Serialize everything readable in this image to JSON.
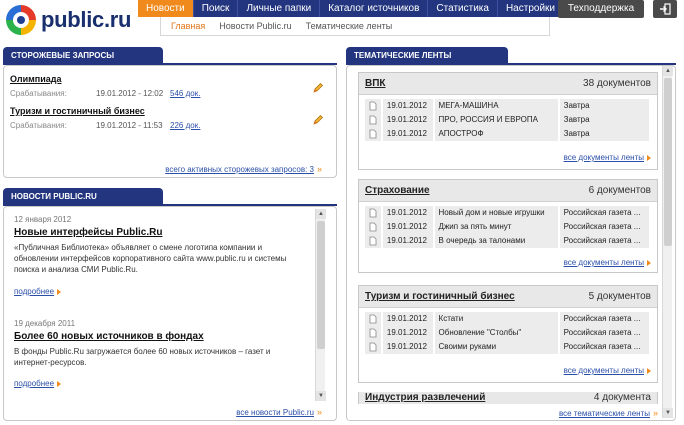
{
  "logo": {
    "text": "public.ru"
  },
  "nav": {
    "items": [
      "Новости",
      "Поиск",
      "Личные папки",
      "Каталог источников",
      "Статистика",
      "Настройки"
    ],
    "active_index": 0
  },
  "subnav": {
    "items": [
      "Главная",
      "Новости Public.ru",
      "Тематические ленты"
    ],
    "active_index": 0
  },
  "support": {
    "label": "Техподдержка"
  },
  "watch": {
    "title": "СТОРОЖЕВЫЕ ЗАПРОСЫ",
    "items": [
      {
        "name": "Олимпиада",
        "label": "Срабатывания:",
        "date": "19.01.2012 - 12:02",
        "count": "546 док."
      },
      {
        "name": "Туризм и гостиничный бизнес",
        "label": "Срабатывания:",
        "date": "19.01.2012 - 11:53",
        "count": "226 док."
      }
    ],
    "all_link": "всего активных сторожевых запросов: 3"
  },
  "news": {
    "title": "НОВОСТИ PUBLIC.RU",
    "items": [
      {
        "date": "12 января 2012",
        "headline": "Новые интерфейсы Public.Ru",
        "text": "«Публичная Библиотека» объявляет о смене логотипа компании и обновлении интерфейсов корпоративного сайта www.public.ru и системы поиска и анализа СМИ Public.Ru.",
        "more": "подробнее"
      },
      {
        "date": "19 декабря 2011",
        "headline": "Более 60 новых источников в фондах",
        "text": "В фонды Public.Ru загружается более 60 новых источников – газет и интернет-ресурсов.",
        "more": "подробнее"
      }
    ],
    "all_link": "все новости Public.ru"
  },
  "feeds": {
    "title": "ТЕМАТИЧЕСКИЕ ЛЕНТЫ",
    "items": [
      {
        "name": "ВПК",
        "count": "38 документов",
        "rows": [
          {
            "date": "19.01.2012",
            "title": "МЕГА-МАШИНА",
            "source": "Завтра"
          },
          {
            "date": "19.01.2012",
            "title": "ПРО, РОССИЯ И ЕВРОПА",
            "source": "Завтра"
          },
          {
            "date": "19.01.2012",
            "title": "АПОСТРОФ",
            "source": "Завтра"
          }
        ],
        "all_link": "все документы ленты"
      },
      {
        "name": "Страхование",
        "count": "6 документов",
        "rows": [
          {
            "date": "19.01.2012",
            "title": "Новый дом и новые игрушки",
            "source": "Российская газета ..."
          },
          {
            "date": "19.01.2012",
            "title": "Джип за пять минут",
            "source": "Российская газета ..."
          },
          {
            "date": "19.01.2012",
            "title": "В очередь за талонами",
            "source": "Российская газета ..."
          }
        ],
        "all_link": "все документы ленты"
      },
      {
        "name": "Туризм и гостиничный бизнес",
        "count": "5 документов",
        "rows": [
          {
            "date": "19.01.2012",
            "title": "Кстати",
            "source": "Российская газета ..."
          },
          {
            "date": "19.01.2012",
            "title": "Обновление \"Столбы\"",
            "source": "Российская газета ..."
          },
          {
            "date": "19.01.2012",
            "title": "Своими руками",
            "source": "Российская газета ..."
          }
        ],
        "all_link": "все документы ленты"
      },
      {
        "name": "Индустрия развлечений",
        "count": "4 документа"
      }
    ],
    "all_link": "все тематические ленты"
  }
}
